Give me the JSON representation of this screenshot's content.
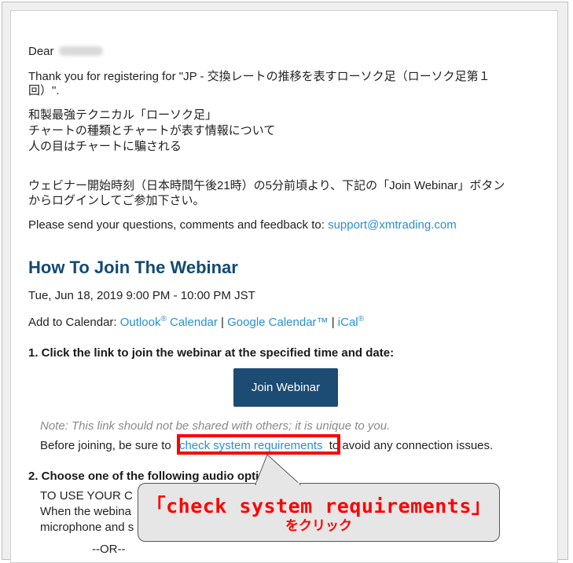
{
  "greeting": {
    "prefix": "Dear"
  },
  "intro": {
    "thanks_line1": "Thank you for registering for \"JP - 交換レートの推移を表すローソク足（ローソク足第１",
    "thanks_line2": "回）\"."
  },
  "topics": [
    "和製最強テクニカル「ローソク足」",
    "チャートの種類とチャートが表す情報について",
    "人の目はチャートに騙される"
  ],
  "notice": {
    "line1": "ウェビナー開始時刻（日本時間午後21時）の5分前頃より、下記の「Join Webinar」ボタン",
    "line2": "からログインしてご参加下さい。"
  },
  "feedback": {
    "text": "Please send your questions, comments and feedback to:",
    "email": "support@xmtrading.com"
  },
  "how_to": {
    "heading": "How To Join The Webinar",
    "datetime": "Tue, Jun 18, 2019 9:00 PM - 10:00 PM JST",
    "calendar_label": "Add to Calendar:",
    "outlook_a": "Outlook",
    "outlook_sup": "®",
    "outlook_b": " Calendar",
    "sep": "|",
    "google": "Google Calendar™",
    "ical": "iCal",
    "ical_sup": "®"
  },
  "step1": {
    "title": "1. Click the link to join the webinar at the specified time and date:",
    "button": "Join Webinar",
    "note": "Note: This link should not be shared with others; it is unique to you.",
    "before_a": "Before joining, be sure to",
    "link": "check system requirements",
    "before_b": "to avoid any connection issues."
  },
  "step2": {
    "title": "2. Choose one of the following audio options:",
    "line1": "TO USE YOUR C",
    "line2": "When the webina",
    "line3": "microphone and s",
    "or": "--OR--"
  },
  "callout": {
    "main": "「check system requirements」",
    "sub": "をクリック",
    "color": "#ff0000"
  }
}
